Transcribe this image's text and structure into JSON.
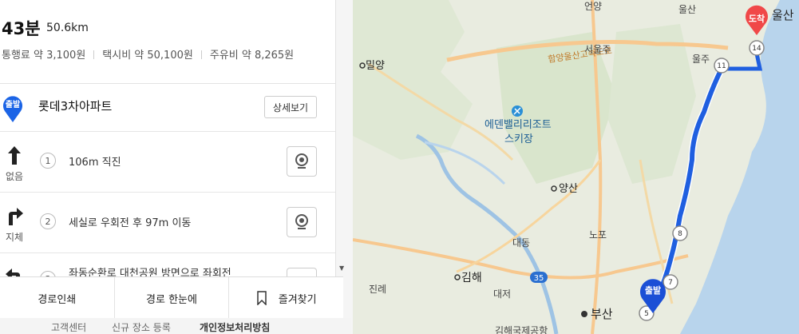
{
  "route": {
    "duration": "43분",
    "distance": "50.6km",
    "toll": "통행료 약 3,100원",
    "taxi": "택시비 약 50,100원",
    "fuel": "주유비 약 8,265원"
  },
  "start": {
    "badge": "출발",
    "name": "롯데3차아파트",
    "detail_label": "상세보기"
  },
  "steps": [
    {
      "num": "1",
      "text": "106m 직진",
      "traffic": "없음",
      "icon": "straight-arrow-icon"
    },
    {
      "num": "2",
      "text": "세실로 우회전 후 97m 이동",
      "traffic": "지체",
      "icon": "turn-right-arrow-icon"
    },
    {
      "num": "3",
      "text": "좌동순환로 대천공원 방면으로 좌회전",
      "traffic": "",
      "icon": "turn-left-arrow-icon"
    }
  ],
  "bottom_buttons": {
    "print": "경로인쇄",
    "overview": "경로 한눈에",
    "favorite": "즐겨찾기"
  },
  "footer": {
    "support": "고객센터",
    "register": "신규 장소 등록",
    "privacy": "개인정보처리방침"
  },
  "map": {
    "route_color": "#1f5fe0",
    "places": {
      "eonyang": "언양",
      "ulsan_top": "울산",
      "ulsan": "울산",
      "miryang": "밀양",
      "seoulju": "서울주",
      "muljeon": "울주",
      "ski_1": "에덴밸리리조트",
      "ski_2": "스키장",
      "yangsan": "양산",
      "daedong": "대동",
      "nopo": "노포",
      "gimhae": "김해",
      "jinrye": "진례",
      "daejeo": "대저",
      "busan": "부산",
      "airport": "김해국제공항"
    },
    "expressway_label": "함양울산고속도로",
    "exit_numbers": [
      "11",
      "14",
      "8",
      "7",
      "5"
    ],
    "route_badge": "35",
    "arrival_badge": "도착",
    "departure_badge": "출발"
  }
}
